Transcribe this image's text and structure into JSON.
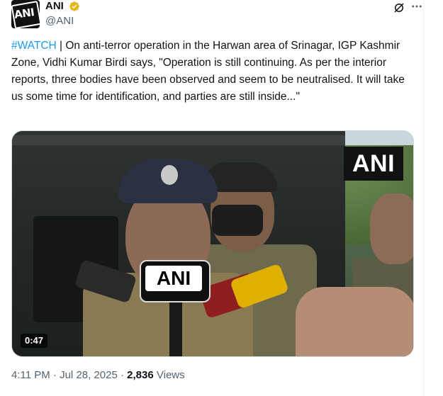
{
  "post": {
    "author": {
      "display_name": "ANI",
      "handle": "@ANI",
      "avatar_text": "ANI",
      "verified_icon": "verified-badge-gold"
    },
    "header_icons": [
      "grok-icon",
      "more-icon"
    ],
    "text": {
      "hashtag": "#WATCH",
      "body": " | On anti-terror operation in the Harwan area of Srinagar, IGP Kashmir Zone, Vidhi Kumar Birdi says, \"Operation is still continuing. As per the interior reports, three bodies have been observed and seem to be neutralised. It will take us some time for identification, and parties are still inside...\""
    },
    "media": {
      "watermark": "ANI",
      "mic_label": "ANI",
      "duration": "0:47"
    },
    "meta": {
      "time": "4:11 PM",
      "separator": "·",
      "date": "Jul 28, 2025",
      "views_count": "2,836",
      "views_label": "Views"
    }
  },
  "colors": {
    "link": "#1d9bf0",
    "secondary_text": "#536471",
    "primary_text": "#0f1419",
    "verified": "#e2b719"
  }
}
